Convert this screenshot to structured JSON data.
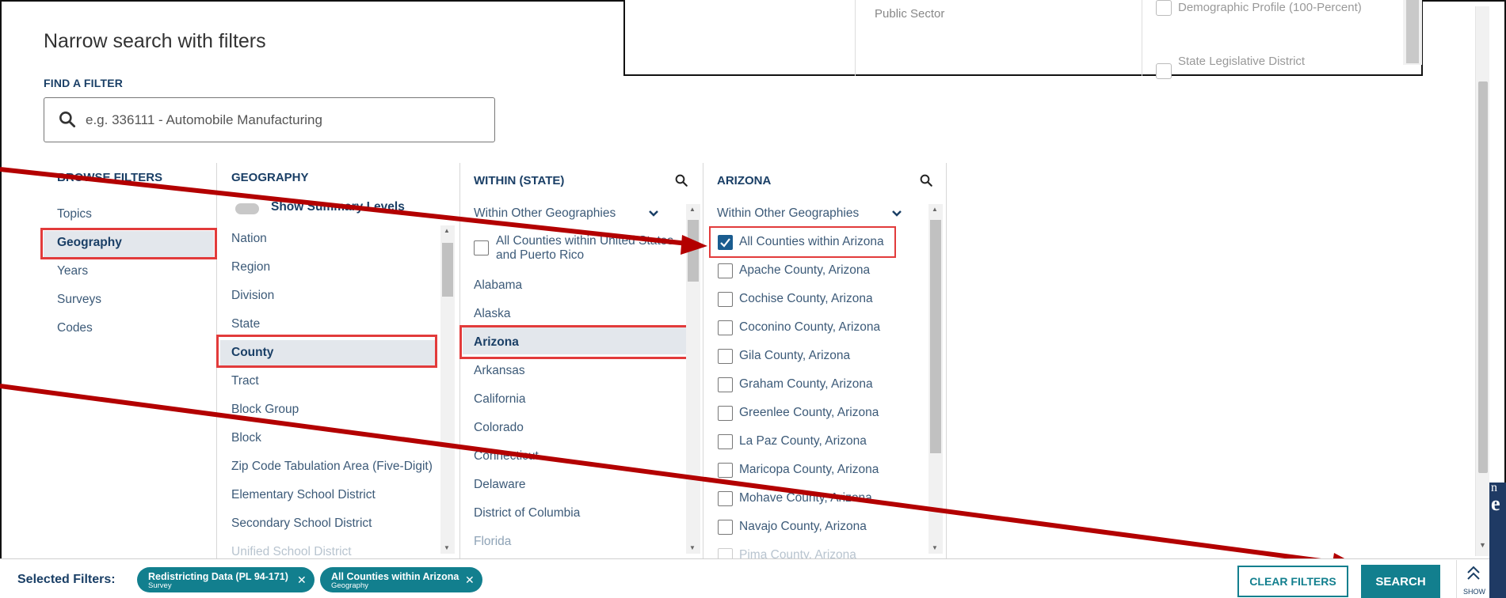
{
  "overlay": {
    "sector_item": "Public Sector",
    "options": [
      "Demographic Profile (100-Percent)",
      "State Legislative District"
    ]
  },
  "filters": {
    "title": "Narrow search with filters",
    "find_label": "FIND A FILTER",
    "search_placeholder": "e.g. 336111 - Automobile Manufacturing"
  },
  "browse": {
    "header": "BROWSE FILTERS",
    "items": [
      "Topics",
      "Geography",
      "Years",
      "Surveys",
      "Codes"
    ],
    "selected": "Geography"
  },
  "geography": {
    "header": "GEOGRAPHY",
    "toggle_label": "Show Summary Levels",
    "items": [
      "Nation",
      "Region",
      "Division",
      "State",
      "County",
      "Tract",
      "Block Group",
      "Block",
      "Zip Code Tabulation Area (Five-Digit)",
      "Elementary School District",
      "Secondary School District",
      "Unified School District"
    ],
    "selected": "County"
  },
  "within_state": {
    "header": "WITHIN (STATE)",
    "dropdown": "Within Other Geographies",
    "all_counties_option": "All Counties within United States and Puerto Rico",
    "all_counties_line1": "All Counties within United States",
    "all_counties_line2": "and Puerto Rico",
    "states": [
      "Alabama",
      "Alaska",
      "Arizona",
      "Arkansas",
      "California",
      "Colorado",
      "Connecticut",
      "Delaware",
      "District of Columbia",
      "Florida"
    ],
    "selected": "Arizona"
  },
  "arizona": {
    "header": "ARIZONA",
    "dropdown": "Within Other Geographies",
    "items": [
      "All Counties within Arizona",
      "Apache County, Arizona",
      "Cochise County, Arizona",
      "Coconino County, Arizona",
      "Gila County, Arizona",
      "Graham County, Arizona",
      "Greenlee County, Arizona",
      "La Paz County, Arizona",
      "Maricopa County, Arizona",
      "Mohave County, Arizona",
      "Navajo County, Arizona",
      "Pima County, Arizona"
    ],
    "checked": [
      "All Counties within Arizona"
    ]
  },
  "bottom": {
    "selected_label": "Selected Filters:",
    "chips": [
      {
        "title": "Redistricting Data (PL 94-171)",
        "sub": "Survey"
      },
      {
        "title": "All Counties within Arizona",
        "sub": "Geography"
      }
    ],
    "clear_label": "CLEAR FILTERS",
    "search_label": "SEARCH",
    "show_label": "SHOW"
  },
  "colors": {
    "teal": "#127f8e",
    "navy": "#1a3f66",
    "highlight_box": "#e23b3b",
    "annotation_arrow": "#b30000"
  }
}
